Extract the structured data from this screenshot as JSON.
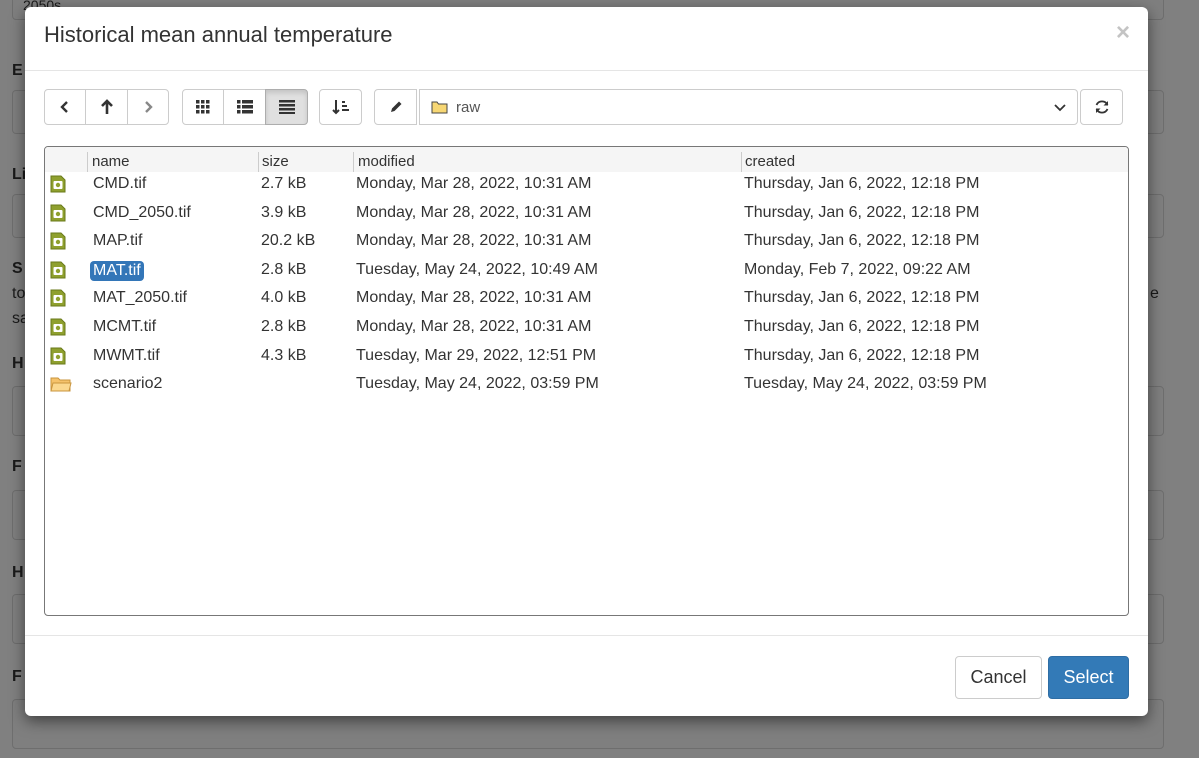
{
  "background": {
    "top_value": "2050s",
    "labels": [
      "E",
      "Li",
      "S",
      "H",
      "F",
      "H",
      "F"
    ],
    "side_text": [
      "to",
      "sa",
      "e"
    ]
  },
  "dialog": {
    "title": "Historical mean annual temperature",
    "close_glyph": "×"
  },
  "toolbar": {
    "directory": "raw",
    "icons": [
      "chevron-left-icon",
      "arrow-up-icon",
      "chevron-right-icon",
      "grid-view-icon",
      "list-view-icon",
      "detail-view-icon",
      "sort-icon",
      "pencil-icon",
      "refresh-icon"
    ]
  },
  "table": {
    "columns": [
      "name",
      "size",
      "modified",
      "created"
    ],
    "rows": [
      {
        "name": "CMD.tif",
        "size": "2.7 kB",
        "modified": "Monday, Mar 28, 2022, 10:31 AM",
        "created": "Thursday, Jan 6, 2022, 12:18 PM",
        "type": "file"
      },
      {
        "name": "CMD_2050.tif",
        "size": "3.9 kB",
        "modified": "Monday, Mar 28, 2022, 10:31 AM",
        "created": "Thursday, Jan 6, 2022, 12:18 PM",
        "type": "file"
      },
      {
        "name": "MAP.tif",
        "size": "20.2 kB",
        "modified": "Monday, Mar 28, 2022, 10:31 AM",
        "created": "Thursday, Jan 6, 2022, 12:18 PM",
        "type": "file"
      },
      {
        "name": "MAT.tif",
        "size": "2.8 kB",
        "modified": "Tuesday, May 24, 2022, 10:49 AM",
        "created": "Monday, Feb 7, 2022, 09:22 AM",
        "type": "file",
        "selected": true
      },
      {
        "name": "MAT_2050.tif",
        "size": "4.0 kB",
        "modified": "Monday, Mar 28, 2022, 10:31 AM",
        "created": "Thursday, Jan 6, 2022, 12:18 PM",
        "type": "file"
      },
      {
        "name": "MCMT.tif",
        "size": "2.8 kB",
        "modified": "Monday, Mar 28, 2022, 10:31 AM",
        "created": "Thursday, Jan 6, 2022, 12:18 PM",
        "type": "file"
      },
      {
        "name": "MWMT.tif",
        "size": "4.3 kB",
        "modified": "Tuesday, Mar 29, 2022, 12:51 PM",
        "created": "Thursday, Jan 6, 2022, 12:18 PM",
        "type": "file"
      },
      {
        "name": "scenario2",
        "size": "",
        "modified": "Tuesday, May 24, 2022, 03:59 PM",
        "created": "Tuesday, May 24, 2022, 03:59 PM",
        "type": "folder"
      }
    ]
  },
  "footer": {
    "cancel_label": "Cancel",
    "select_label": "Select"
  },
  "colors": {
    "accent": "#337ab7",
    "selection": "#3376b8",
    "file_icon": "#8a9a2a",
    "folder_icon": "#f0c060"
  }
}
